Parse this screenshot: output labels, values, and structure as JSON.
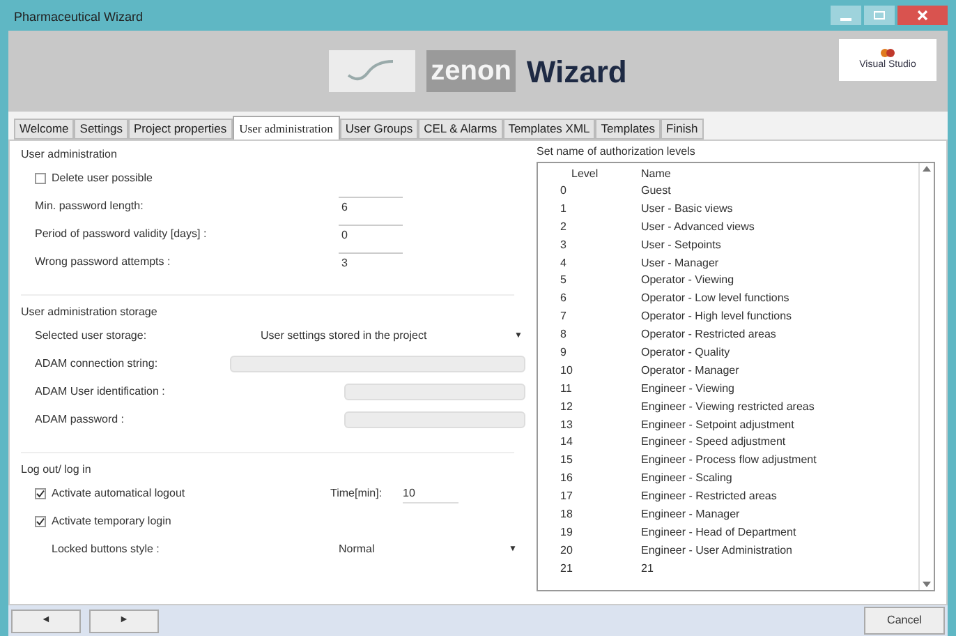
{
  "window": {
    "title": "Pharmaceutical Wizard"
  },
  "header": {
    "brand": "zenon",
    "title": "Wizard",
    "badge": "Visual Studio"
  },
  "tabs": [
    {
      "label": "Welcome",
      "selected": false
    },
    {
      "label": "Settings",
      "selected": false
    },
    {
      "label": "Project properties",
      "selected": false
    },
    {
      "label": "User administration",
      "selected": true
    },
    {
      "label": "User Groups",
      "selected": false
    },
    {
      "label": "CEL & Alarms",
      "selected": false
    },
    {
      "label": "Templates XML",
      "selected": false
    },
    {
      "label": "Templates",
      "selected": false
    },
    {
      "label": "Finish",
      "selected": false
    }
  ],
  "sections": [
    {
      "title": "User administration",
      "rows": [
        {
          "kind": "checkbox",
          "label": "Delete user possible",
          "checked": false
        },
        {
          "kind": "field",
          "label": "Min. password length:",
          "value": "6"
        },
        {
          "kind": "field",
          "label": "Period of password validity [days] :",
          "value": "0"
        },
        {
          "kind": "field",
          "label": "Wrong password attempts :",
          "value": "3"
        }
      ]
    },
    {
      "title": "User administration storage",
      "rows": [
        {
          "kind": "dropdown",
          "label": "Selected user storage:",
          "value": "User settings stored in the project",
          "arrow": "▼"
        },
        {
          "kind": "disabled",
          "label": "ADAM connection string:",
          "wide": true
        },
        {
          "kind": "disabled",
          "label": "ADAM User identification :",
          "wide": false
        },
        {
          "kind": "disabled",
          "label": "ADAM password :",
          "wide": false
        }
      ]
    },
    {
      "title": "Log out/ log in",
      "rows": [
        {
          "kind": "checkbox",
          "label": "Activate automatical logout",
          "checked": true,
          "extra_label": "Time[min]:",
          "extra_value": "10"
        },
        {
          "kind": "checkbox",
          "label": "Activate temporary login",
          "checked": true
        },
        {
          "kind": "dropdown",
          "label": "Locked buttons style :",
          "value": "Normal",
          "arrow": "▼",
          "indent": true
        }
      ]
    }
  ],
  "levels": {
    "title": "Set name of authorization levels",
    "columns": [
      "Level",
      "Name"
    ],
    "rows": [
      [
        "0",
        "Guest"
      ],
      [
        "1",
        "User - Basic views"
      ],
      [
        "2",
        "User - Advanced views"
      ],
      [
        "3",
        "User - Setpoints"
      ],
      [
        "4",
        "User - Manager"
      ],
      [
        "5",
        "Operator - Viewing"
      ],
      [
        "6",
        "Operator - Low level functions"
      ],
      [
        "7",
        "Operator - High level functions"
      ],
      [
        "8",
        "Operator - Restricted areas"
      ],
      [
        "9",
        "Operator - Quality"
      ],
      [
        "10",
        "Operator - Manager"
      ],
      [
        "11",
        "Engineer - Viewing"
      ],
      [
        "12",
        "Engineer - Viewing restricted areas"
      ],
      [
        "13",
        "Engineer - Setpoint adjustment"
      ],
      [
        "14",
        "Engineer - Speed adjustment"
      ],
      [
        "15",
        "Engineer - Process flow adjustment"
      ],
      [
        "16",
        "Engineer - Scaling"
      ],
      [
        "17",
        "Engineer - Restricted areas"
      ],
      [
        "18",
        "Engineer - Manager"
      ],
      [
        "19",
        "Engineer - Head of Department"
      ],
      [
        "20",
        "Engineer - User Administration"
      ],
      [
        "21",
        "21"
      ]
    ]
  },
  "footer": {
    "back": "◄",
    "next": "►",
    "cancel": "Cancel"
  }
}
